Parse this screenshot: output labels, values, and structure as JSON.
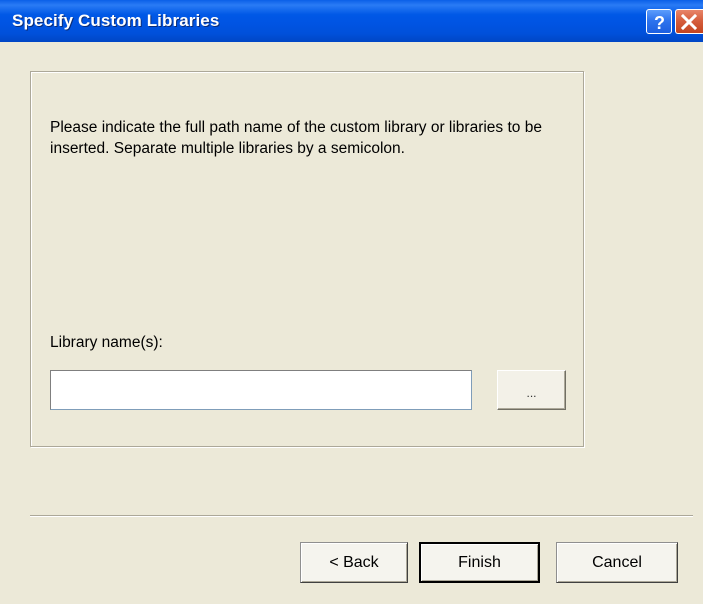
{
  "window": {
    "title": "Specify Custom Libraries",
    "help_button_label": "?",
    "close_button_label": "X"
  },
  "panel": {
    "instructions": "Please indicate the full path name of the custom library or libraries to be inserted. Separate multiple libraries by a semicolon.",
    "library_label": "Library name(s):",
    "library_value": "",
    "browse_label": "..."
  },
  "footer": {
    "back_label": "< Back",
    "finish_label": "Finish",
    "cancel_label": "Cancel"
  },
  "colors": {
    "titlebar": "#0054e3",
    "dialog_background": "#ece9d8",
    "close_button": "#c4441f"
  }
}
